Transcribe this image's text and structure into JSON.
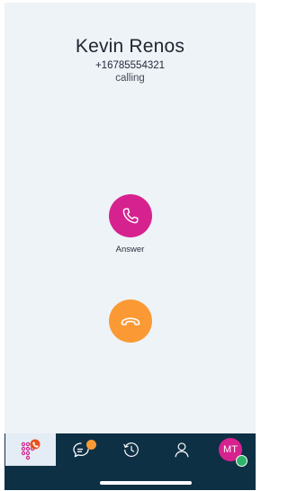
{
  "caller": {
    "name": "Kevin Renos",
    "number": "+16785554321",
    "status": "calling"
  },
  "actions": {
    "answer_label": "Answer",
    "answer_icon": "phone-icon",
    "decline_icon": "hang-up-icon"
  },
  "tabbar": {
    "tabs": [
      {
        "id": "dialer",
        "icon": "dialpad-call-icon",
        "active": true
      },
      {
        "id": "chat",
        "icon": "chat-bubble-icon",
        "badge": true
      },
      {
        "id": "history",
        "icon": "history-icon"
      },
      {
        "id": "contacts",
        "icon": "person-icon"
      },
      {
        "id": "profile",
        "icon": "avatar",
        "initials": "MT",
        "presence": "online"
      }
    ]
  },
  "colors": {
    "background": "#eef3f8",
    "answer": "#d6228f",
    "decline": "#fb9a34",
    "tabbar": "#0e3045",
    "tab_active": "#e4ecf5",
    "presence_online": "#2db46a"
  }
}
